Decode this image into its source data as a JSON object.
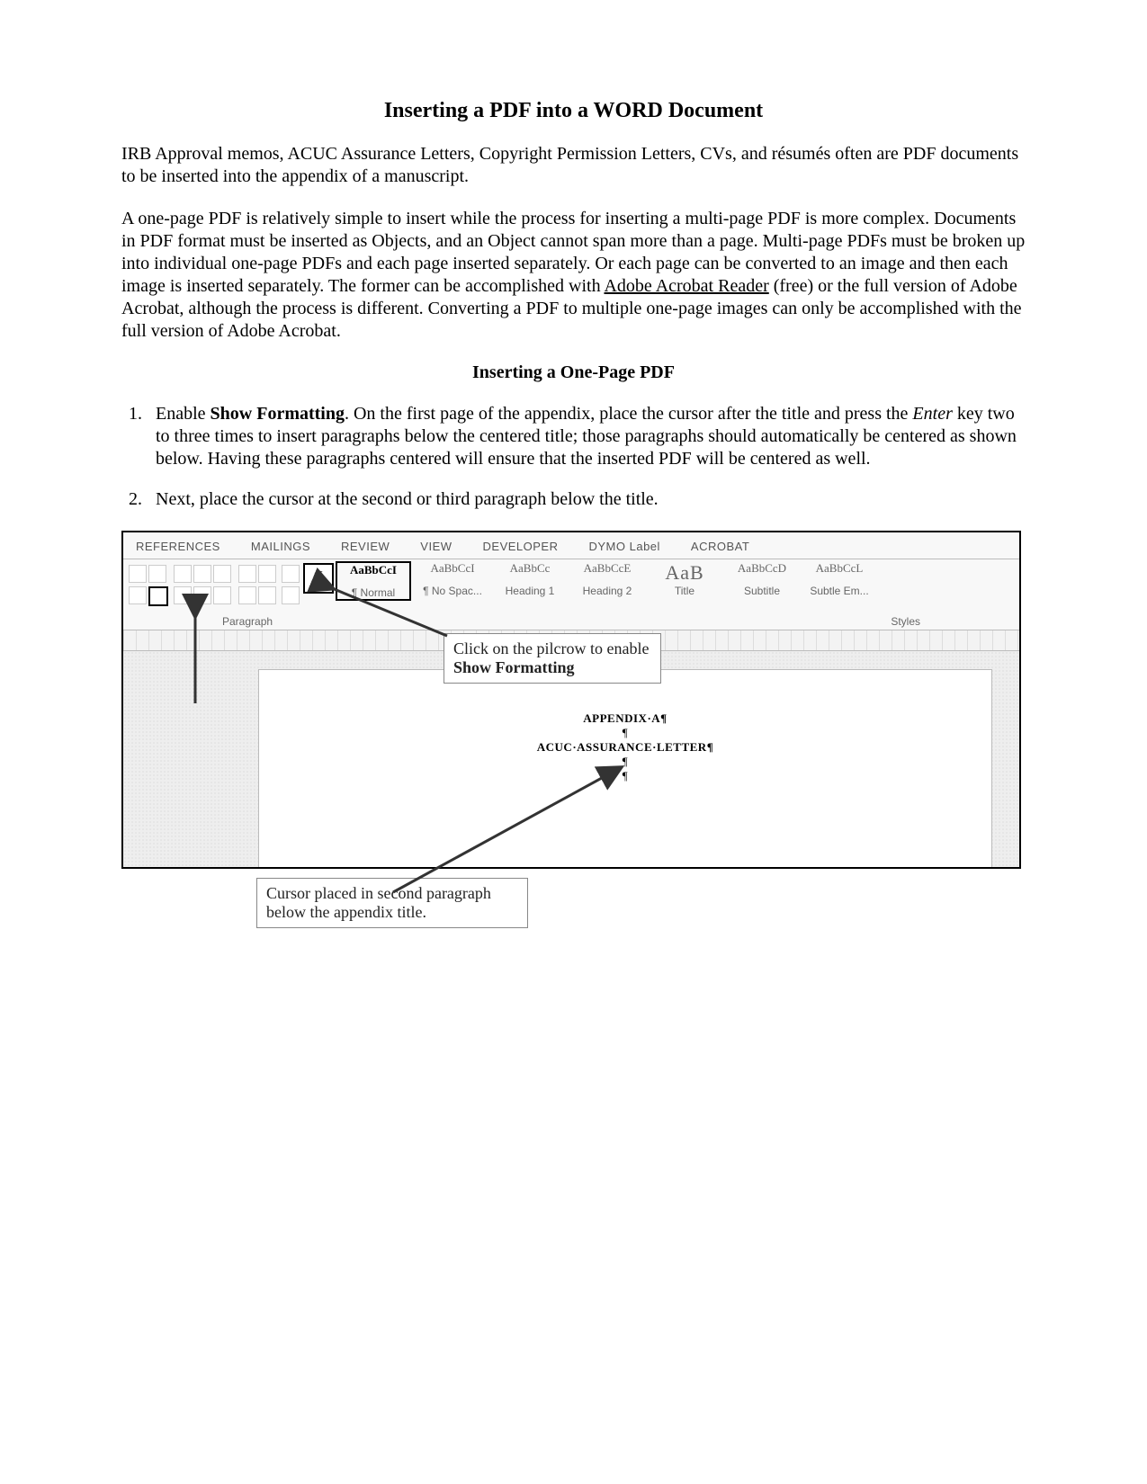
{
  "doc": {
    "title": "Inserting a PDF into a WORD Document",
    "intro1": "IRB Approval memos, ACUC Assurance Letters, Copyright Permission Letters, CVs, and résumés often are PDF documents to be inserted into the appendix of a manuscript.",
    "intro2_a": "A one-page PDF is relatively simple to insert while the process for inserting a multi-page PDF is more complex. Documents in PDF format must be inserted as Objects, and an Object cannot span more than a page. Multi-page PDFs must be broken up into individual one-page PDFs and each page inserted separately. Or each page can be converted to an image and then each image is inserted separately. The former can be accomplished with ",
    "intro2_link": "Adobe Acrobat Reader",
    "intro2_b": " (free) or the full version of Adobe Acrobat, although the process is different. Converting a PDF to multiple one-page images can only be accomplished with the full version of Adobe Acrobat.",
    "subtitle": "Inserting a One-Page PDF",
    "step1_a": "Enable ",
    "step1_bold": "Show Formatting",
    "step1_b": ". On the first page of the appendix, place the cursor after the title and press the ",
    "step1_italic": "Enter",
    "step1_c": " key two to three times to insert paragraphs below the centered title; those paragraphs should automatically be centered as shown below. Having these paragraphs centered will ensure that the inserted PDF will be centered as well.",
    "step2": "Next, place the cursor at the second or third paragraph below the title."
  },
  "ribbon": {
    "tabs": [
      "REFERENCES",
      "MAILINGS",
      "REVIEW",
      "VIEW",
      "DEVELOPER",
      "DYMO Label",
      "ACROBAT"
    ],
    "pilcrow": "¶",
    "group_paragraph": "Paragraph",
    "group_styles": "Styles",
    "styles": [
      {
        "preview": "AaBbCcI",
        "label": "¶ Normal",
        "cls": "normal"
      },
      {
        "preview": "AaBbCcI",
        "label": "¶ No Spac...",
        "cls": ""
      },
      {
        "preview": "AaBbCc",
        "label": "Heading 1",
        "cls": ""
      },
      {
        "preview": "AaBbCcE",
        "label": "Heading 2",
        "cls": ""
      },
      {
        "preview": "AaB",
        "label": "Title",
        "cls": "title"
      },
      {
        "preview": "AaBbCcD",
        "label": "Subtitle",
        "cls": ""
      },
      {
        "preview": "AaBbCcL",
        "label": "Subtle Em...",
        "cls": ""
      }
    ]
  },
  "docarea": {
    "line1": "APPENDIX·A¶",
    "line2": "¶",
    "line3": "ACUC·ASSURANCE·LETTER¶",
    "line4": "¶",
    "cursor": "¶"
  },
  "callouts": {
    "pilcrow_a": "Click on the pilcrow to enable ",
    "pilcrow_b": "Show Formatting",
    "cursor": "Cursor placed in second paragraph below the appendix title."
  }
}
